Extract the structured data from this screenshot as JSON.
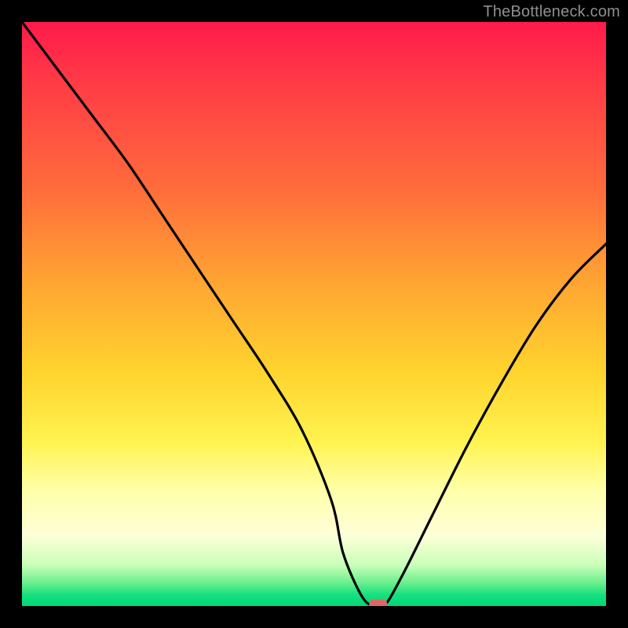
{
  "watermark": "TheBottleneck.com",
  "colors": {
    "frame": "#000000",
    "curve": "#000000",
    "marker": "#e06666",
    "gradient_top": "#ff1a4a",
    "gradient_bottom": "#00d87a"
  },
  "chart_data": {
    "type": "line",
    "title": "",
    "xlabel": "",
    "ylabel": "",
    "xlim": [
      0,
      100
    ],
    "ylim": [
      0,
      100
    ],
    "grid": false,
    "legend": false,
    "annotations": [],
    "series": [
      {
        "name": "bottleneck-curve",
        "x": [
          0,
          6,
          12,
          18,
          24,
          30,
          36,
          42,
          48,
          53,
          55,
          58,
          60,
          62,
          65,
          70,
          76,
          82,
          88,
          94,
          100
        ],
        "values": [
          100,
          92,
          84,
          76,
          67,
          58,
          49,
          40,
          30,
          18,
          9,
          2,
          0,
          0,
          5,
          15,
          27,
          38,
          48,
          56,
          62
        ]
      }
    ],
    "marker": {
      "x": 61,
      "y": 0,
      "shape": "rounded-rect"
    },
    "background": "vertical-heat-gradient"
  }
}
